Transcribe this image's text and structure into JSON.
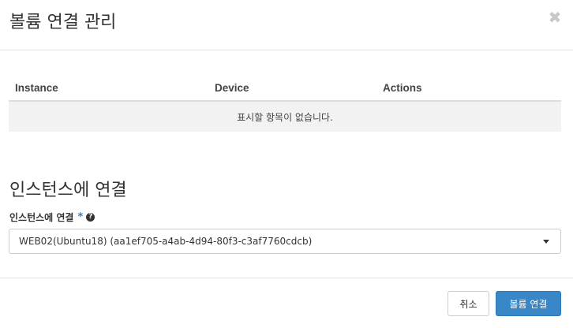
{
  "dialog": {
    "title": "볼륨 연결 관리",
    "close_icon": "close-icon"
  },
  "table": {
    "columns": [
      "Instance",
      "Device",
      "Actions"
    ],
    "empty_message": "표시할 항목이 없습니다."
  },
  "attach_section": {
    "title": "인스턴스에 연결",
    "field_label": "인스턴스에 연결",
    "required_marker": "*",
    "help_icon_glyph": "?",
    "selected_instance": "WEB02(Ubuntu18) (aa1ef705-a4ab-4d94-80f3-c3af7760cdcb)"
  },
  "footer": {
    "cancel_label": "취소",
    "submit_label": "볼륨 연결"
  },
  "colors": {
    "primary": "#3a87c8",
    "required": "#2f80c5",
    "empty_row_bg": "#f2f2f2"
  }
}
